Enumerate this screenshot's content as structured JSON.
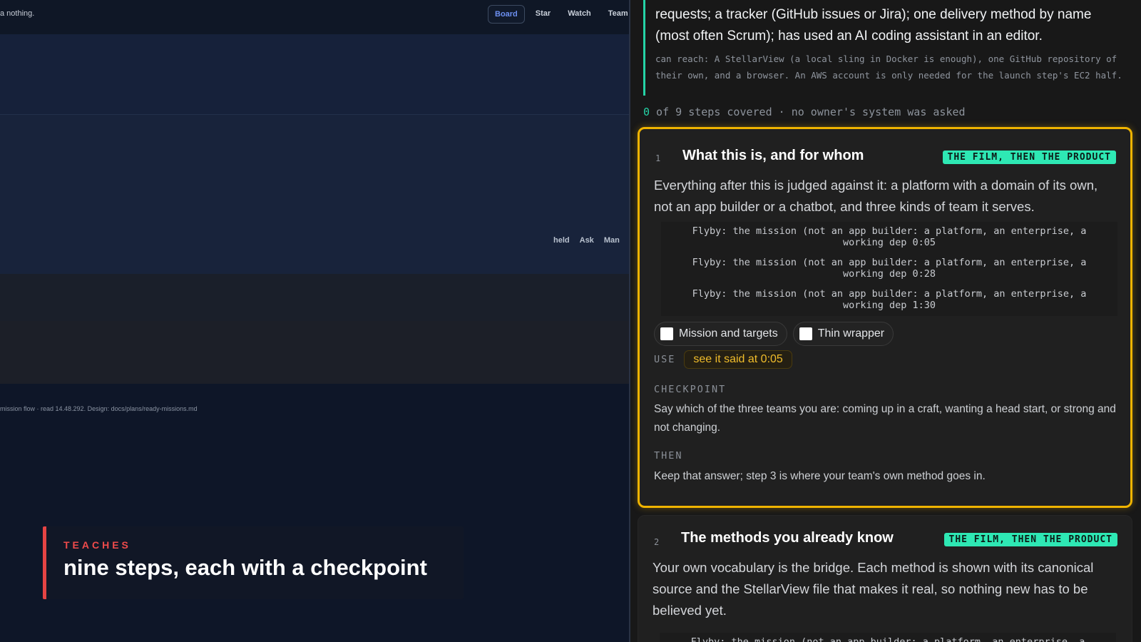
{
  "left_app": {
    "top_note": "a nothing.",
    "tabs": [
      {
        "label": "Board",
        "active": true
      },
      {
        "label": "Star",
        "active": false
      },
      {
        "label": "Watch",
        "active": false
      },
      {
        "label": "Team",
        "active": false
      }
    ],
    "actions": [
      "held",
      "Ask",
      "Man"
    ],
    "footnote": "mission flow · read 14.48.292. Design: docs/plans/ready-missions.md"
  },
  "caption": {
    "kicker": "TEACHES",
    "headline": "nine steps, each with a checkpoint"
  },
  "audience": {
    "lead": "requests; a tracker (GitHub issues or Jira); one delivery method by name (most often Scrum); has used an AI coding assistant in an editor.",
    "reach": "can reach: A StellarView (a local sling in Docker is enough), one GitHub repository of their own, and a browser. An AWS account is only needed for the launch step's EC2 half."
  },
  "progress": {
    "count": "0",
    "rest": " of 9 steps covered · no owner's system was asked"
  },
  "steps": [
    {
      "number": "1",
      "title": "What this is, and for whom",
      "tag": "THE FILM, THEN THE PRODUCT",
      "description": "Everything after this is judged against it: a platform with a domain of its own, not an app builder or a chatbot, and three kinds of team it serves.",
      "cues": [
        {
          "line1": "Flyby: the mission (not an app builder: a platform, an enterprise, a",
          "line2": "working dep 0:05"
        },
        {
          "line1": "Flyby: the mission (not an app builder: a platform, an enterprise, a",
          "line2": "working dep 0:28"
        },
        {
          "line1": "Flyby: the mission (not an app builder: a platform, an enterprise, a",
          "line2": "working dep 1:30"
        }
      ],
      "checks": [
        "Mission and targets",
        "Thin wrapper"
      ],
      "use_label": "USE",
      "use_button": "see it said at 0:05",
      "checkpoint_label": "CHECKPOINT",
      "checkpoint_text": "Say which of the three teams you are: coming up in a craft, wanting a head start, or strong and not changing.",
      "then_label": "THEN",
      "then_text": "Keep that answer; step 3 is where your team's own method goes in."
    },
    {
      "number": "2",
      "title": "The methods you already know",
      "tag": "THE FILM, THEN THE PRODUCT",
      "description": "Your own vocabulary is the bridge. Each method is shown with its canonical source and the StellarView file that makes it real, so nothing new has to be believed yet.",
      "cues": [
        {
          "line1": "Flyby: the mission (not an app builder: a platform, an enterprise, a",
          "line2": ""
        }
      ]
    }
  ],
  "colors": {
    "accent_green": "#2ee8b4",
    "highlight_border": "#f0b400",
    "caption_red": "#ef4b4b",
    "use_button_text": "#f1bd2b"
  }
}
